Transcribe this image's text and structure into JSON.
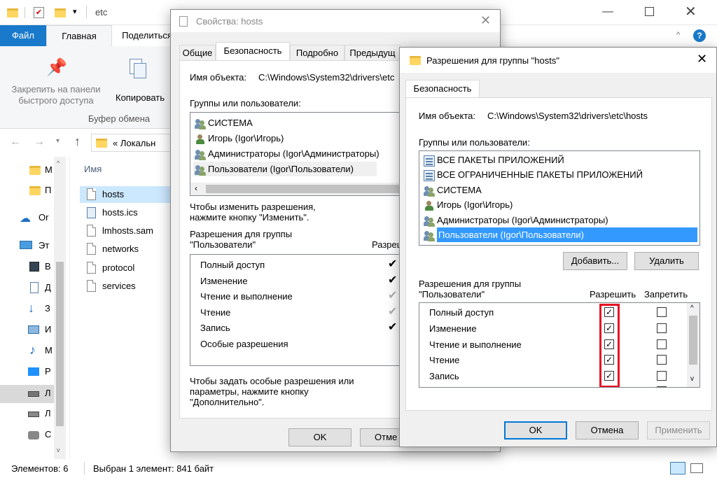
{
  "explorer": {
    "title": "etc",
    "tabs": [
      "Файл",
      "Главная",
      "Поделиться"
    ],
    "ribbon": {
      "pin_label": "Закрепить на панели быстрого доступа",
      "copy_label": "Копировать",
      "group_label": "Буфер обмена"
    },
    "address": "«  Локальн",
    "column_name": "Имя",
    "files": [
      "hosts",
      "hosts.ics",
      "lmhosts.sam",
      "networks",
      "protocol",
      "services"
    ],
    "nav_items": [
      "М",
      "П",
      "Or",
      "Эт",
      "В",
      "Д",
      "З",
      "И",
      "М",
      "Р",
      "Л",
      "Л",
      "С"
    ],
    "status_count": "Элементов: 6",
    "status_selected": "Выбран 1 элемент: 841 байт"
  },
  "props_dialog": {
    "title": "Свойства: hosts",
    "tabs": [
      "Общие",
      "Безопасность",
      "Подробно",
      "Предыдущ"
    ],
    "object_label": "Имя объекта:",
    "object_value": "C:\\Windows\\System32\\drivers\\etc",
    "groups_label": "Группы или пользователи:",
    "groups": [
      "СИСТЕМА",
      "Игорь (Igor\\Игорь)",
      "Администраторы (Igor\\Администраторы)",
      "Пользователи (Igor\\Пользователи)"
    ],
    "change_hint": "Чтобы изменить разрешения, нажмите кнопку \"Изменить\".",
    "perm_header_1": "Разрешения для группы",
    "perm_header_2": "\"Пользователи\"",
    "perm_allow_col": "Разреш",
    "permissions": [
      "Полный доступ",
      "Изменение",
      "Чтение и выполнение",
      "Чтение",
      "Запись",
      "Особые разрешения"
    ],
    "special_hint": "Чтобы задать особые разрешения или параметры, нажмите кнопку \"Дополнительно\".",
    "ok": "OK",
    "cancel": "Отме"
  },
  "perm_dialog": {
    "title": "Разрешения для группы \"hosts\"",
    "tab": "Безопасность",
    "object_label": "Имя объекта:",
    "object_value": "C:\\Windows\\System32\\drivers\\etc\\hosts",
    "groups_label": "Группы или пользователи:",
    "groups": [
      "ВСЕ ПАКЕТЫ ПРИЛОЖЕНИЙ",
      "ВСЕ ОГРАНИЧЕННЫЕ ПАКЕТЫ ПРИЛОЖЕНИЙ",
      "СИСТЕМА",
      "Игорь (Igor\\Игорь)",
      "Администраторы (Igor\\Администраторы)",
      "Пользователи (Igor\\Пользователи)"
    ],
    "add": "Добавить...",
    "remove": "Удалить",
    "perm_header_1": "Разрешения для группы",
    "perm_header_2": "\"Пользователи\"",
    "allow_col": "Разрешить",
    "deny_col": "Запретить",
    "permissions": [
      "Полный доступ",
      "Изменение",
      "Чтение и выполнение",
      "Чтение",
      "Запись"
    ],
    "ok": "OK",
    "cancel": "Отмена",
    "apply": "Применить",
    "highlight_color": "#e81123",
    "selection_color": "#3399ff"
  }
}
